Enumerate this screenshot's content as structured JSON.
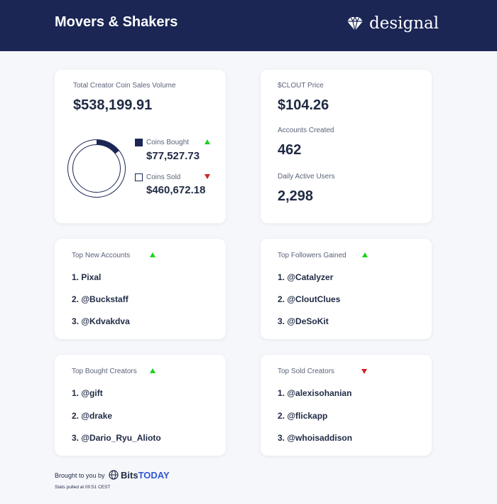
{
  "header": {
    "title": "Movers & Shakers",
    "brand": "designal"
  },
  "sales": {
    "label": "Total Creator Coin Sales Volume",
    "total": "$538,199.91",
    "bought_label": "Coins Bought",
    "bought_value": "$77,527.73",
    "sold_label": "Coins Sold",
    "sold_value": "$460,672.18",
    "bought_fraction": 0.144
  },
  "stats": {
    "clout_label": "$CLOUT Price",
    "clout_value": "$104.26",
    "accounts_label": "Accounts Created",
    "accounts_value": "462",
    "dau_label": "Daily Active Users",
    "dau_value": "2,298"
  },
  "top_new_accounts": {
    "title": "Top New Accounts",
    "trend": "up",
    "items": [
      "1. Pixal",
      "2. @Buckstaff",
      "3. @Kdvakdva"
    ]
  },
  "top_followers": {
    "title": "Top Followers Gained",
    "trend": "up",
    "items": [
      "1. @Catalyzer",
      "2. @CloutClues",
      "3. @DeSoKit"
    ]
  },
  "top_bought": {
    "title": "Top Bought Creators",
    "trend": "up",
    "items": [
      "1. @gift",
      "2. @drake",
      "3. @Dario_Ryu_Alioto"
    ]
  },
  "top_sold": {
    "title": "Top Sold Creators",
    "trend": "down",
    "items": [
      "1. @alexisohanian",
      "2. @flickapp",
      "3. @whoisaddison"
    ]
  },
  "footer": {
    "brought": "Brought to you by",
    "logo_bits": "Bits",
    "logo_today": "TODAY",
    "stats_time": "Stats pulled at 00:51 CEST"
  },
  "colors": {
    "navy": "#1b2655",
    "up": "#1fd11f",
    "down": "#d22424",
    "accent_today": "#2f58d6"
  }
}
